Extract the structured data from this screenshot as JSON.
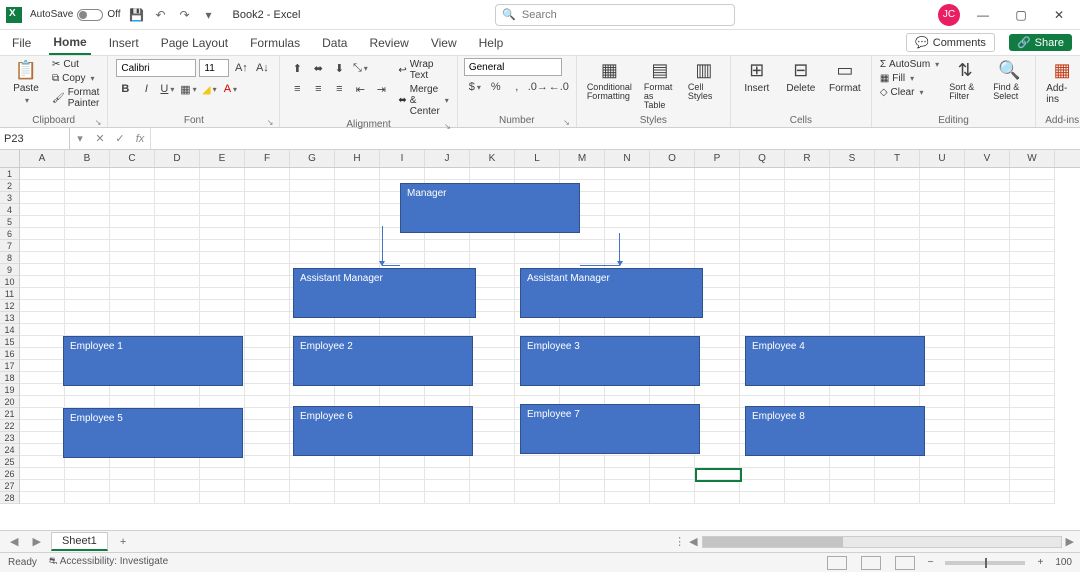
{
  "titlebar": {
    "autosave_label": "AutoSave",
    "autosave_state": "Off",
    "doc_title": "Book2 - Excel",
    "search_placeholder": "Search",
    "user_initials": "JC"
  },
  "menu": {
    "tabs": [
      "File",
      "Home",
      "Insert",
      "Page Layout",
      "Formulas",
      "Data",
      "Review",
      "View",
      "Help"
    ],
    "active": "Home",
    "comments": "Comments",
    "share": "Share"
  },
  "ribbon": {
    "clipboard": {
      "paste": "Paste",
      "cut": "Cut",
      "copy": "Copy",
      "format_painter": "Format Painter",
      "label": "Clipboard"
    },
    "font": {
      "name": "Calibri",
      "size": "11",
      "label": "Font"
    },
    "alignment": {
      "wrap": "Wrap Text",
      "merge": "Merge & Center",
      "label": "Alignment"
    },
    "number": {
      "format": "General",
      "label": "Number"
    },
    "styles": {
      "cond": "Conditional Formatting",
      "table": "Format as Table",
      "cell": "Cell Styles",
      "label": "Styles"
    },
    "cells": {
      "insert": "Insert",
      "delete": "Delete",
      "format": "Format",
      "label": "Cells"
    },
    "editing": {
      "autosum": "AutoSum",
      "fill": "Fill",
      "clear": "Clear",
      "sort": "Sort & Filter",
      "find": "Find & Select",
      "label": "Editing"
    },
    "addins": {
      "label": "Add-ins"
    }
  },
  "namebox": "P23",
  "columns": [
    "A",
    "B",
    "C",
    "D",
    "E",
    "F",
    "G",
    "H",
    "I",
    "J",
    "K",
    "L",
    "M",
    "N",
    "O",
    "P",
    "Q",
    "R",
    "S",
    "T",
    "U",
    "V",
    "W"
  ],
  "row_count": 28,
  "chart_data": {
    "type": "org-chart",
    "nodes": [
      {
        "id": "mgr",
        "label": "Manager",
        "level": 0
      },
      {
        "id": "am1",
        "label": "Assistant Manager",
        "level": 1,
        "parent": "mgr"
      },
      {
        "id": "am2",
        "label": "Assistant Manager",
        "level": 1,
        "parent": "mgr"
      },
      {
        "id": "e1",
        "label": "Employee 1",
        "level": 2,
        "parent": "am1"
      },
      {
        "id": "e2",
        "label": "Employee 2",
        "level": 2,
        "parent": "am1"
      },
      {
        "id": "e3",
        "label": "Employee 3",
        "level": 2,
        "parent": "am2"
      },
      {
        "id": "e4",
        "label": "Employee 4",
        "level": 2,
        "parent": "am2"
      },
      {
        "id": "e5",
        "label": "Employee 5",
        "level": 3,
        "parent": "am1"
      },
      {
        "id": "e6",
        "label": "Employee 6",
        "level": 3,
        "parent": "am1"
      },
      {
        "id": "e7",
        "label": "Employee 7",
        "level": 3,
        "parent": "am2"
      },
      {
        "id": "e8",
        "label": "Employee 8",
        "level": 3,
        "parent": "am2"
      }
    ]
  },
  "sheets": {
    "active": "Sheet1"
  },
  "status": {
    "ready": "Ready",
    "accessibility": "Accessibility: Investigate",
    "zoom": "100"
  }
}
